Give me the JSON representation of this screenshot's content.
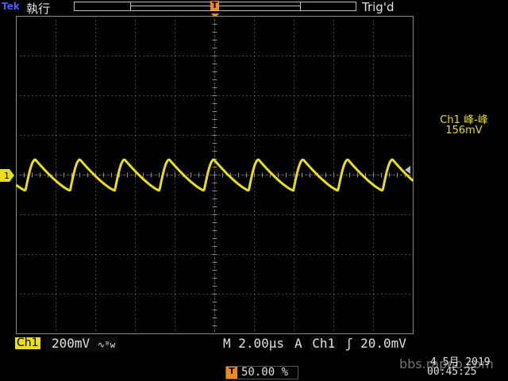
{
  "header": {
    "brand": "Tek",
    "run_state": "執行",
    "trigger_status": "Trig'd",
    "trigger_marker": "T"
  },
  "measurement": {
    "title": "Ch1 峰-峰",
    "value": "156mV"
  },
  "status_bar": {
    "channel": "Ch1",
    "volts_per_div": "200mV",
    "coupling_symbol": "∿ᴮw",
    "timebase": "M 2.00µs",
    "trigger_mode": "A",
    "trigger_source": "Ch1",
    "trigger_slope": "ʃ",
    "trigger_level": "20.0mV",
    "trigger_position": "50.00 %",
    "date": "4 5月  2019",
    "time": "00:45:25"
  },
  "channel_marker": "1",
  "watermark": "bbs.rapoo.com",
  "colors": {
    "ch1": "#e8de1a",
    "trigger": "#f28a1a",
    "graticule": "#8a8a8a",
    "background": "#000000"
  },
  "graticule": {
    "h_divs": 10,
    "v_divs": 8
  },
  "waveform": {
    "type": "sawtooth",
    "period_us": 2.25,
    "amplitude_mv_pp": 156,
    "offset_divs": 0
  }
}
